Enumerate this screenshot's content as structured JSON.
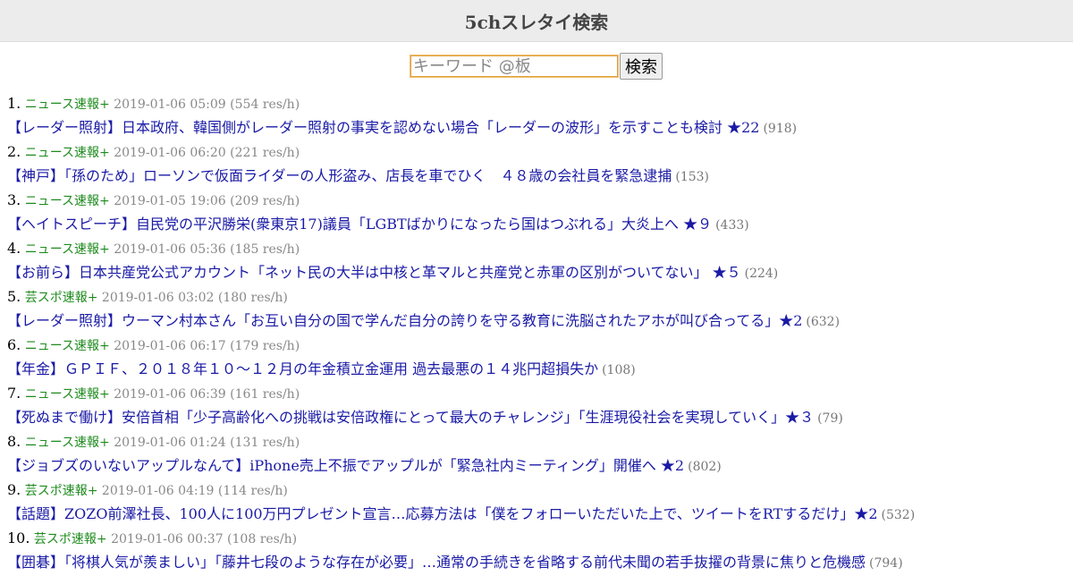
{
  "header": {
    "title": "5chスレタイ検索"
  },
  "search": {
    "placeholder": "キーワード @板",
    "button_label": "検索"
  },
  "results": [
    {
      "num": "1.",
      "board": "ニュース速報+",
      "info": "2019-01-06 05:09 (554 res/h)",
      "title": "【レーダー照射】日本政府、韓国側がレーダー照射の事実を認めない場合「レーダーの波形」を示すことも検討 ★22",
      "count": "(918)"
    },
    {
      "num": "2.",
      "board": "ニュース速報+",
      "info": "2019-01-06 06:20 (221 res/h)",
      "title": "【神戸】「孫のため」ローソンで仮面ライダーの人形盗み、店長を車でひく　４８歳の会社員を緊急逮捕",
      "count": "(153)"
    },
    {
      "num": "3.",
      "board": "ニュース速報+",
      "info": "2019-01-05 19:06 (209 res/h)",
      "title": "【ヘイトスピーチ】自民党の平沢勝栄(衆東京17)議員「LGBTばかりになったら国はつぶれる」大炎上へ ★９",
      "count": "(433)"
    },
    {
      "num": "4.",
      "board": "ニュース速報+",
      "info": "2019-01-06 05:36 (185 res/h)",
      "title": "【お前ら】日本共産党公式アカウント「ネット民の大半は中核と革マルと共産党と赤軍の区別がついてない」 ★５",
      "count": "(224)"
    },
    {
      "num": "5.",
      "board": "芸スポ速報+",
      "info": "2019-01-06 03:02 (180 res/h)",
      "title": "【レーダー照射】ウーマン村本さん「お互い自分の国で学んだ自分の誇りを守る教育に洗脳されたアホが叫び合ってる」★2",
      "count": "(632)"
    },
    {
      "num": "6.",
      "board": "ニュース速報+",
      "info": "2019-01-06 06:17 (179 res/h)",
      "title": "【年金】ＧＰＩＦ、２０１８年１０～１２月の年金積立金運用 過去最悪の１４兆円超損失か",
      "count": "(108)"
    },
    {
      "num": "7.",
      "board": "ニュース速報+",
      "info": "2019-01-06 06:39 (161 res/h)",
      "title": "【死ぬまで働け】安倍首相「少子高齢化への挑戦は安倍政権にとって最大のチャレンジ」「生涯現役社会を実現していく」★３",
      "count": "(79)"
    },
    {
      "num": "8.",
      "board": "ニュース速報+",
      "info": "2019-01-06 01:24 (131 res/h)",
      "title": "【ジョブズのいないアップルなんて】iPhone売上不振でアップルが「緊急社内ミーティング」開催へ ★2",
      "count": "(802)"
    },
    {
      "num": "9.",
      "board": "芸スポ速報+",
      "info": "2019-01-06 04:19 (114 res/h)",
      "title": "【話題】ZOZO前澤社長、100人に100万円プレゼント宣言…応募方法は「僕をフォローいただいた上で、ツイートをRTするだけ」★2",
      "count": "(532)"
    },
    {
      "num": "10.",
      "board": "芸スポ速報+",
      "info": "2019-01-06 00:37 (108 res/h)",
      "title": "【囲碁】「将棋人気が羨ましい」「藤井七段のような存在が必要」…通常の手続きを省略する前代未聞の若手抜擢の背景に焦りと危機感",
      "count": "(794)"
    }
  ]
}
